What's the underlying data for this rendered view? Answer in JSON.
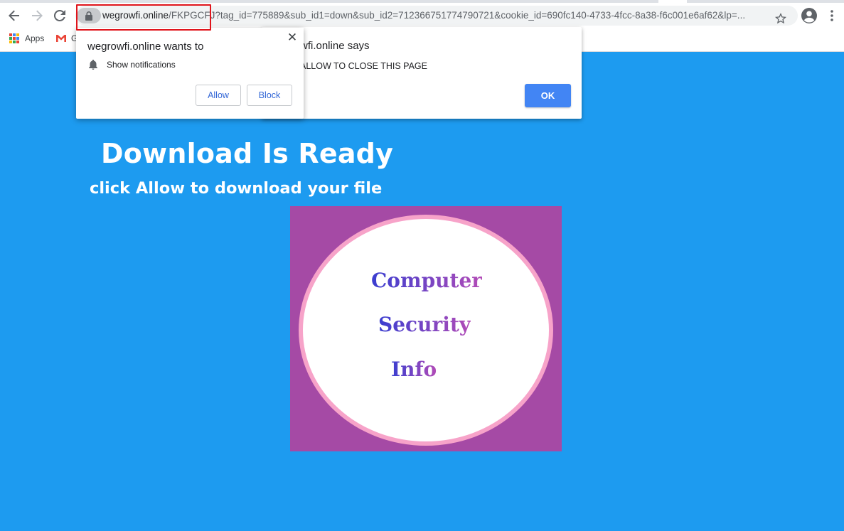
{
  "browser": {
    "url_host": "wegrowfi.online",
    "url_path": "/FKPGCFJ?tag_id=775889&sub_id1=down&sub_id2=712366751774790721&cookie_id=690fc140-4733-4fcc-8a38-f6c001e6af62&lp=...",
    "bookmarks": [
      {
        "label": "Apps",
        "icon": "apps-grid-icon"
      },
      {
        "label": "G",
        "icon": "gmail-icon"
      }
    ],
    "nav_icons": [
      "back-arrow-icon",
      "forward-arrow-icon",
      "reload-icon",
      "lock-icon",
      "star-icon",
      "account-icon",
      "menu-dots-icon"
    ]
  },
  "permission_prompt": {
    "title": "wegrowfi.online wants to",
    "permission_label": "Show notifications",
    "allow_label": "Allow",
    "block_label": "Block",
    "close_glyph": "✕"
  },
  "alert": {
    "title": "wfi.online says",
    "message": "ALLOW TO CLOSE THIS PAGE",
    "ok_label": "OK"
  },
  "page": {
    "headline": "Download Is Ready",
    "subline": "click Allow to download your file",
    "logo": {
      "word1": "Computer",
      "word2": "Security",
      "word3": "Info"
    }
  },
  "colors": {
    "page_background": "#1d9bf0",
    "logo_background": "#a54aa5",
    "logo_ring": "#f7a3c9",
    "highlight_box": "#e0141b",
    "button_blue": "#4285f4"
  }
}
